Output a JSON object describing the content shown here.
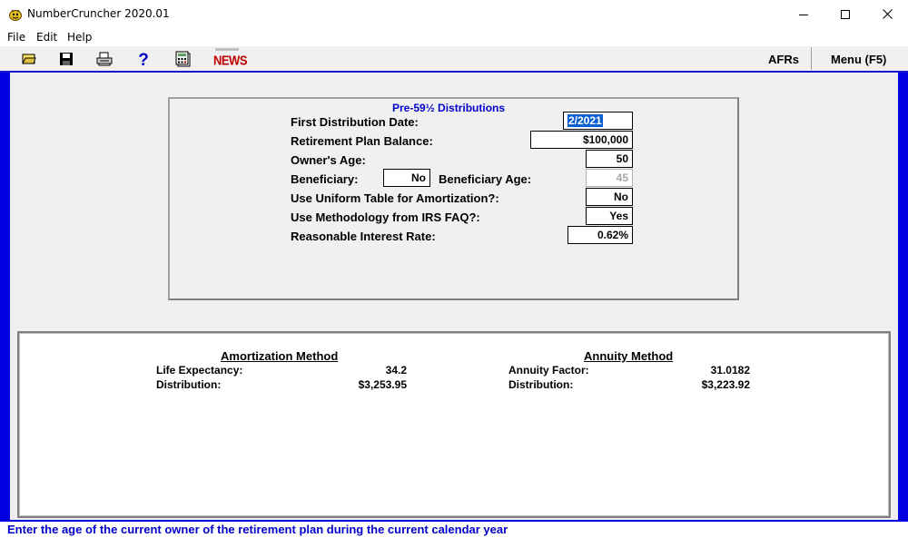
{
  "window": {
    "title": "NumberCruncher 2020.01",
    "controls": {
      "minimize": "minimize-icon",
      "maximize": "maximize-icon",
      "close": "close-icon"
    }
  },
  "menu": {
    "items": [
      "File",
      "Edit",
      "Help"
    ]
  },
  "toolbar": {
    "icons": [
      "open-folder-icon",
      "save-icon",
      "print-icon",
      "help-icon",
      "calculator-icon"
    ],
    "news_label": "NEWS",
    "afrs_label": "AFRs",
    "menu_label": "Menu (F5)"
  },
  "form": {
    "title": "Pre-59½ Distributions",
    "first_distribution_date": {
      "label": "First Distribution Date:",
      "value": "2/2021"
    },
    "plan_balance": {
      "label": "Retirement Plan Balance:",
      "value": "$100,000"
    },
    "owner_age": {
      "label": "Owner's Age:",
      "value": "50"
    },
    "beneficiary": {
      "label": "Beneficiary:",
      "value": "No"
    },
    "beneficiary_age": {
      "label": "Beneficiary Age:",
      "value": "45"
    },
    "uniform_table": {
      "label": "Use Uniform Table for Amortization?:",
      "value": "No"
    },
    "irs_faq": {
      "label": "Use Methodology from IRS FAQ?:",
      "value": "Yes"
    },
    "interest_rate": {
      "label": "Reasonable Interest Rate:",
      "value": "0.62%"
    }
  },
  "results": {
    "amortization": {
      "title": "Amortization Method",
      "life_expectancy_label": "Life Expectancy:",
      "life_expectancy_value": "34.2",
      "distribution_label": "Distribution:",
      "distribution_value": "$3,253.95"
    },
    "annuity": {
      "title": "Annuity Method",
      "factor_label": "Annuity Factor:",
      "factor_value": "31.0182",
      "distribution_label": "Distribution:",
      "distribution_value": "$3,223.92"
    }
  },
  "status": {
    "text": "Enter the age of the current owner of the retirement plan during the current calendar year"
  },
  "colors": {
    "frame": "#0000e0",
    "accent_text": "#0000cc",
    "news": "#c00000",
    "selection": "#0a5fd0"
  }
}
